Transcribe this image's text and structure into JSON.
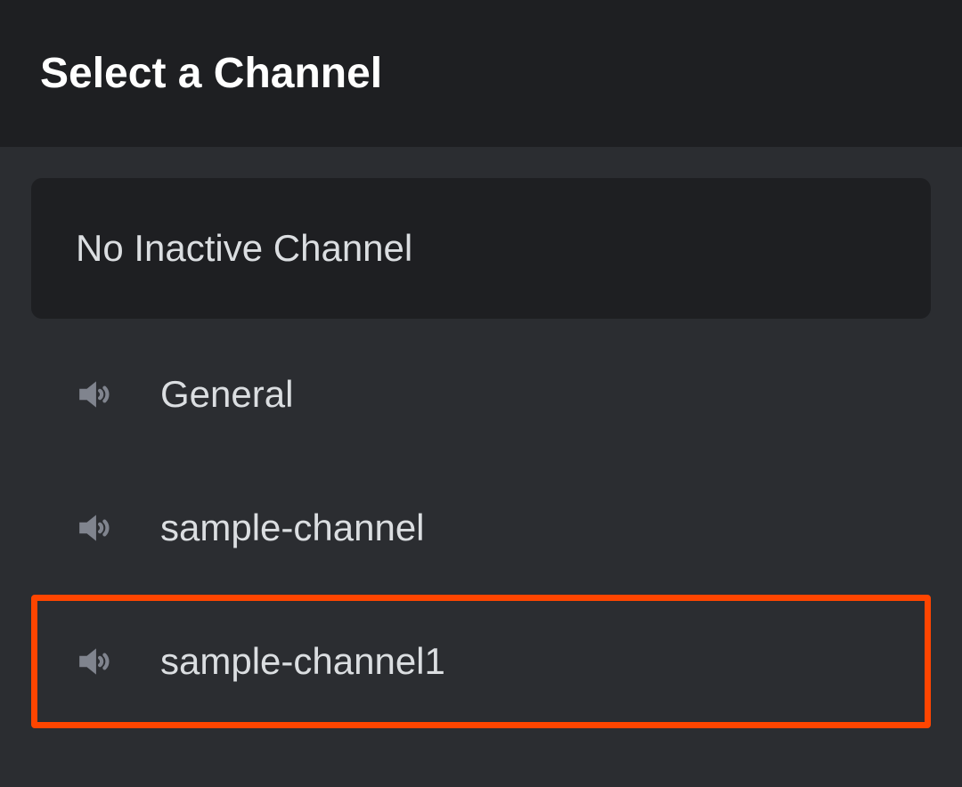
{
  "header": {
    "title": "Select a Channel"
  },
  "noInactive": {
    "label": "No Inactive Channel"
  },
  "channels": [
    {
      "label": "General",
      "highlighted": false
    },
    {
      "label": "sample-channel",
      "highlighted": false
    },
    {
      "label": "sample-channel1",
      "highlighted": true
    }
  ]
}
